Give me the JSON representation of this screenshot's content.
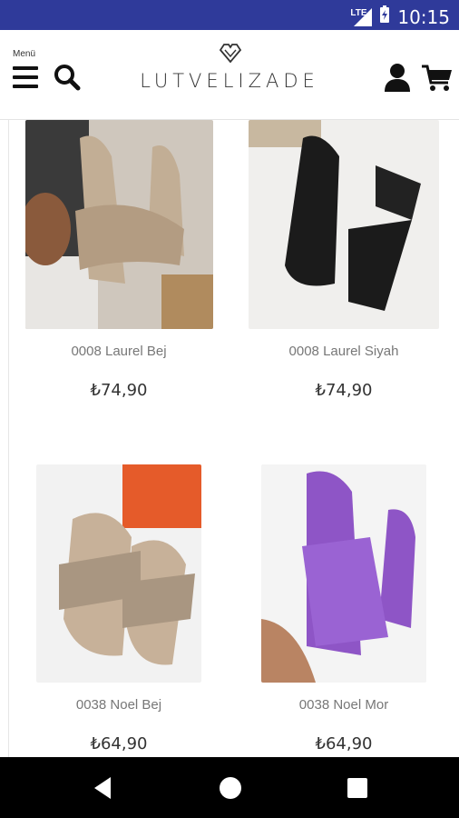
{
  "status": {
    "network": "LTE",
    "time": "10:15"
  },
  "header": {
    "menu_label": "Menü",
    "brand": "LUTVELIZADE"
  },
  "products": [
    {
      "name": "0008 Laurel Bej",
      "price": "₺74,90",
      "colors": {
        "bg": "#cfc7bd",
        "shoe": "#c2ae95"
      }
    },
    {
      "name": "0008 Laurel Siyah",
      "price": "₺74,90",
      "colors": {
        "bg": "#f0efed",
        "shoe": "#1b1b1b"
      }
    },
    {
      "name": "0038 Noel Bej",
      "price": "₺64,90",
      "colors": {
        "bg": "#f2f2f2",
        "shoe": "#a99681"
      }
    },
    {
      "name": "0038 Noel Mor",
      "price": "₺64,90",
      "colors": {
        "bg": "#f4f4f4",
        "shoe": "#8e55c6"
      }
    }
  ]
}
